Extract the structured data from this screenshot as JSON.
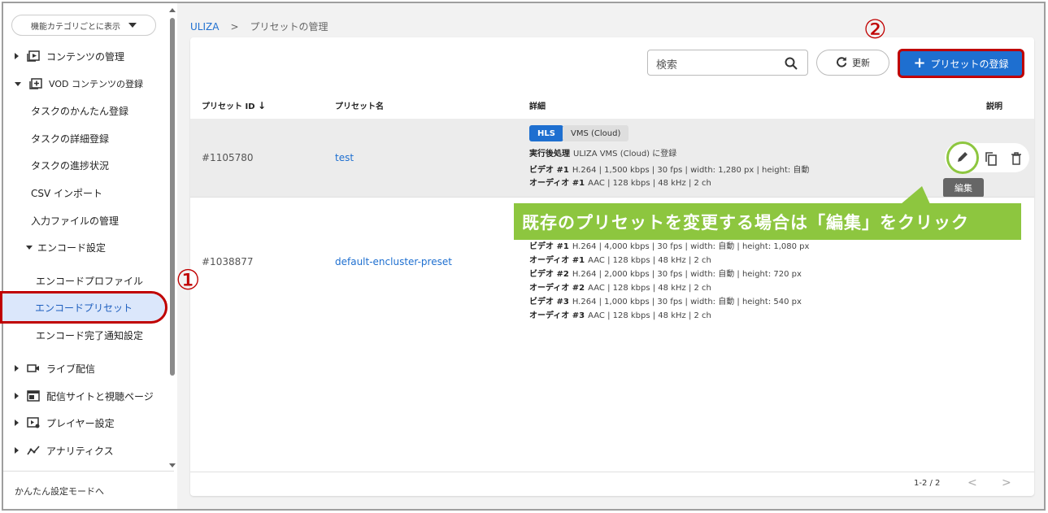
{
  "sidebar": {
    "category_button": "機能カテゴリごとに表示",
    "items": [
      {
        "label": "コンテンツの管理"
      },
      {
        "label": "VOD コンテンツの登録"
      },
      {
        "label": "タスクのかんたん登録"
      },
      {
        "label": "タスクの詳細登録"
      },
      {
        "label": "タスクの進捗状況"
      },
      {
        "label": "CSV インポート"
      },
      {
        "label": "入力ファイルの管理"
      },
      {
        "label": "エンコード設定"
      },
      {
        "label": "エンコードプロファイル"
      },
      {
        "label": "エンコードプリセット"
      },
      {
        "label": "エンコード完了通知設定"
      },
      {
        "label": "ライブ配信"
      },
      {
        "label": "配信サイトと視聴ページ"
      },
      {
        "label": "プレイヤー設定"
      },
      {
        "label": "アナリティクス"
      }
    ],
    "easy_mode_link": "かんたん設定モードへ"
  },
  "annotations": {
    "marker_1": "①",
    "marker_2": "②",
    "callout": "既存のプリセットを変更する場合は「編集」をクリック"
  },
  "breadcrumb": {
    "root": "ULIZA",
    "separator": ">",
    "current": "プリセットの管理"
  },
  "toolbar": {
    "search_placeholder": "検索",
    "refresh_label": "更新",
    "register_label": "プリセットの登録"
  },
  "table": {
    "headers": {
      "id": "プリセット ID",
      "name": "プリセット名",
      "detail": "詳細",
      "description": "説明"
    },
    "rows": [
      {
        "id": "#1105780",
        "name": "test",
        "tags": [
          "HLS",
          "VMS (Cloud)"
        ],
        "lines": [
          {
            "key": "実行後処理",
            "value": "ULIZA VMS (Cloud) に登録"
          },
          {
            "key": "ビデオ #1",
            "value": "H.264 | 1,500 kbps | 30 fps | width: 1,280 px | height: 自動"
          },
          {
            "key": "オーディオ #1",
            "value": "AAC | 128 kbps | 48 kHz | 2 ch"
          }
        ]
      },
      {
        "id": "#1038877",
        "name": "default-encluster-preset",
        "lines": [
          {
            "key": "ビデオ #1",
            "value": "H.264 | 4,000 kbps | 30 fps | width: 自動 | height: 1,080 px"
          },
          {
            "key": "オーディオ #1",
            "value": "AAC | 128 kbps | 48 kHz | 2 ch"
          },
          {
            "key": "ビデオ #2",
            "value": "H.264 | 2,000 kbps | 30 fps | width: 自動 | height: 720 px"
          },
          {
            "key": "オーディオ #2",
            "value": "AAC | 128 kbps | 48 kHz | 2 ch"
          },
          {
            "key": "ビデオ #3",
            "value": "H.264 | 1,000 kbps | 30 fps | width: 自動 | height: 540 px"
          },
          {
            "key": "オーディオ #3",
            "value": "AAC | 128 kbps | 48 kHz | 2 ch"
          }
        ]
      }
    ],
    "tooltip_edit": "編集"
  },
  "pagination": {
    "range": "1-2 / 2",
    "prev": "<",
    "next": ">"
  }
}
